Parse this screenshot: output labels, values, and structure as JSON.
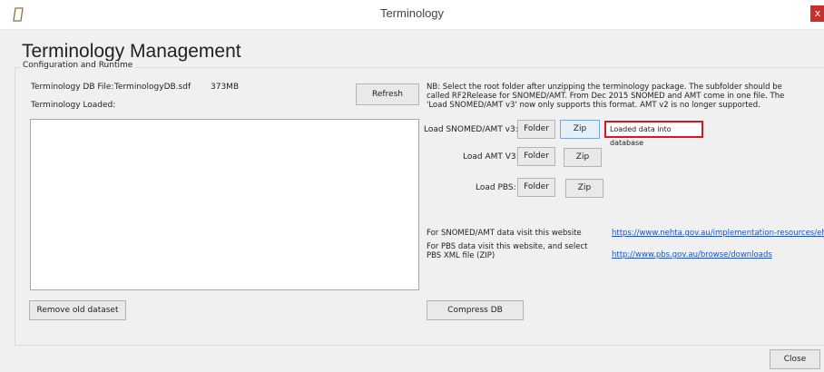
{
  "window": {
    "title": "Terminology",
    "close_glyph": "x"
  },
  "heading": "Terminology Management",
  "group_label": "Configuration and Runtime",
  "db": {
    "file_label": "Terminology DB File:",
    "file_name": "TerminologyDB.sdf",
    "file_size": "373MB",
    "loaded_label": "Terminology Loaded:"
  },
  "buttons": {
    "refresh": "Refresh",
    "remove_old": "Remove old dataset",
    "compress": "Compress DB",
    "close": "Close",
    "folder": "Folder",
    "zip": "Zip"
  },
  "note": "NB: Select the root folder after unzipping the terminology package.  The subfolder should be called RF2Release for SNOMED/AMT. From Dec 2015 SNOMED and AMT come in one file. The 'Load SNOMED/AMT v3' now only supports this format. AMT v2 is no longer supported.",
  "loaders": [
    {
      "label": "Load SNOMED/AMT v3:"
    },
    {
      "label": "Load AMT V3:"
    },
    {
      "label": "Load PBS:"
    }
  ],
  "status_message": "Loaded data into database",
  "links": {
    "snomed_text": "For SNOMED/AMT data visit this website",
    "snomed_url": "https://www.nehta.gov.au/implementation-resources/ehealth-fou",
    "pbs_text_1": "For PBS data visit this website, and select",
    "pbs_text_2": "PBS XML file (ZIP)",
    "pbs_url": "http://www.pbs.gov.au/browse/downloads"
  },
  "colors": {
    "status_border": "#e0151b",
    "link": "#1a4fd0",
    "close_button": "#c9302c"
  },
  "icons": {
    "app": "document-icon"
  }
}
